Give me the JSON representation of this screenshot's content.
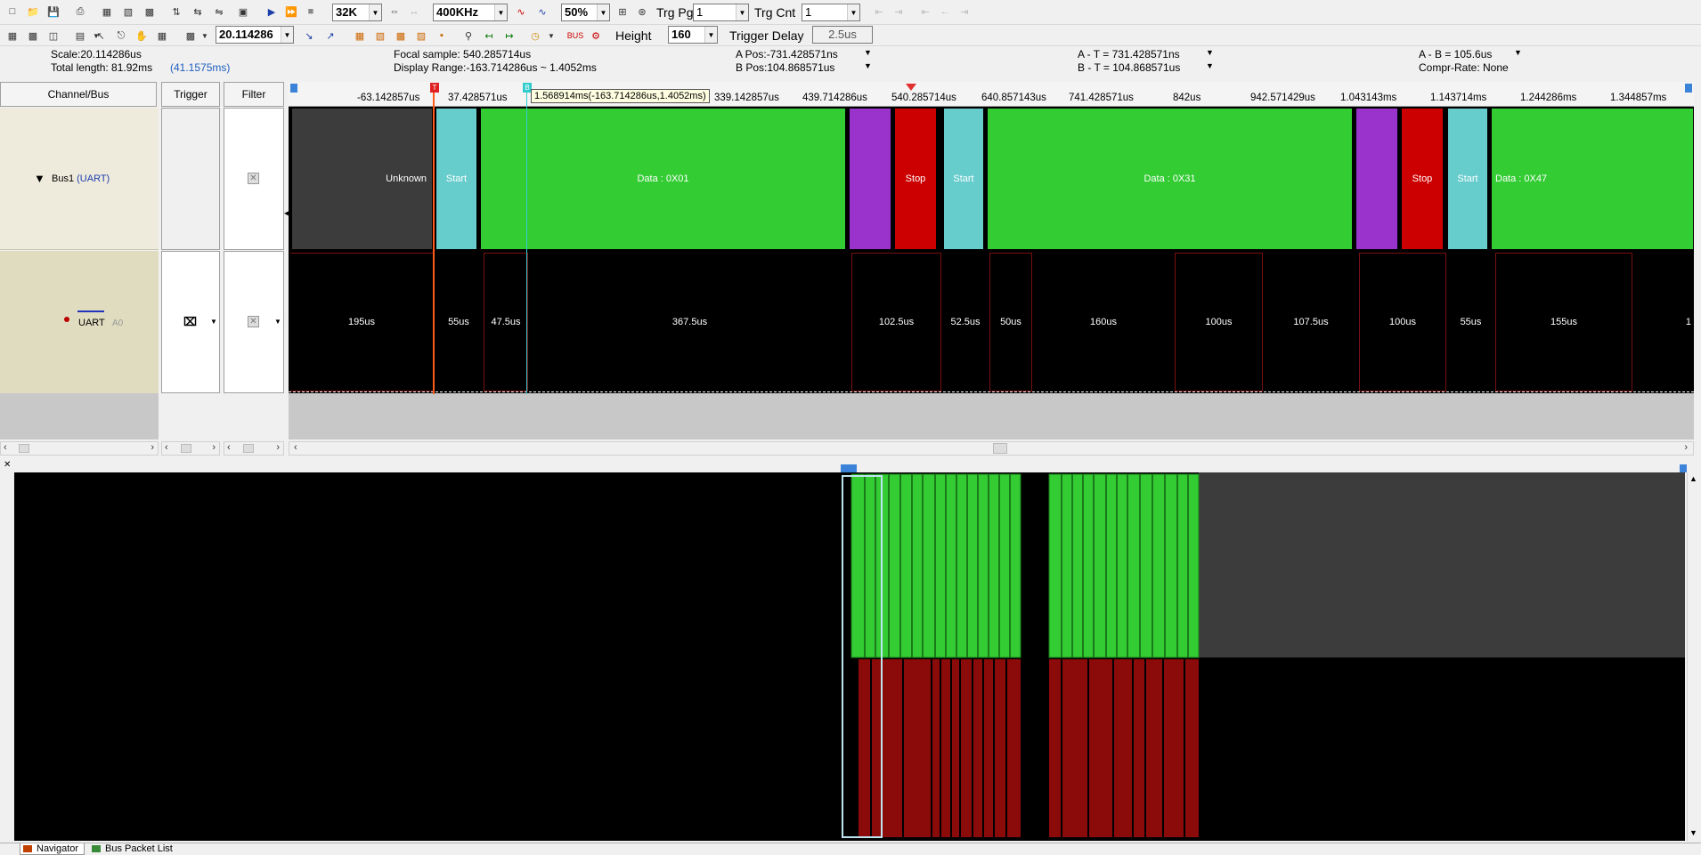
{
  "toolbar1": {
    "buffer_size": "32K",
    "sample_rate": "400KHz",
    "trigger_pos": "50%",
    "trg_pg_label": "Trg Pg",
    "trg_pg_value": "1",
    "trg_cnt_label": "Trg Cnt",
    "trg_cnt_value": "1"
  },
  "toolbar2": {
    "scale_value": "20.114286",
    "height_label": "Height",
    "height_value": "160",
    "trigger_delay_label": "Trigger Delay",
    "trigger_delay_value": "2.5us"
  },
  "info": {
    "scale": "Scale:20.114286us",
    "total_length": "Total length: 81.92ms",
    "total_length_extra": "(41.1575ms)",
    "focal_sample": "Focal sample: 540.285714us",
    "display_range": "Display Range:-163.714286us ~ 1.4052ms",
    "a_pos": "A Pos:-731.428571ns",
    "b_pos": "B Pos:104.868571us",
    "a_t": "A - T = 731.428571ns",
    "b_t": "B - T = 104.868571us",
    "a_b": "A - B = 105.6us",
    "compr_rate": "Compr-Rate: None"
  },
  "panel_headers": {
    "channel_bus": "Channel/Bus",
    "trigger": "Trigger",
    "filter": "Filter"
  },
  "channels": {
    "bus_name": "Bus1",
    "bus_type": "(UART)",
    "ch_name": "UART",
    "ch_id": "A0"
  },
  "tooltip": "1.568914ms(-163.714286us,1.4052ms)",
  "ruler_ticks": [
    "-63.142857us",
    "37.428571us",
    "339.142857us",
    "439.714286us",
    "540.285714us",
    "640.857143us",
    "741.428571us",
    "842us",
    "942.571429us",
    "1.043143ms",
    "1.143714ms",
    "1.244286ms",
    "1.344857ms"
  ],
  "bus_segments": [
    "Unknown",
    "Start",
    "Data : 0X01",
    "",
    "Stop",
    "Start",
    "Data : 0X31",
    "",
    "Stop",
    "Start",
    "Data : 0X47"
  ],
  "durations": [
    "195us",
    "55us",
    "47.5us",
    "367.5us",
    "102.5us",
    "52.5us",
    "50us",
    "160us",
    "100us",
    "107.5us",
    "100us",
    "55us",
    "155us",
    "1"
  ],
  "colors": {
    "unknown": "#3c3c3c",
    "start": "#66cccc",
    "data": "#33cc33",
    "parity": "#9933cc",
    "stop": "#cc0000",
    "cursor_a": "#ff3300",
    "cursor_b": "#33cccc"
  },
  "bottom_tabs": [
    "Navigator",
    "Bus Packet List"
  ]
}
